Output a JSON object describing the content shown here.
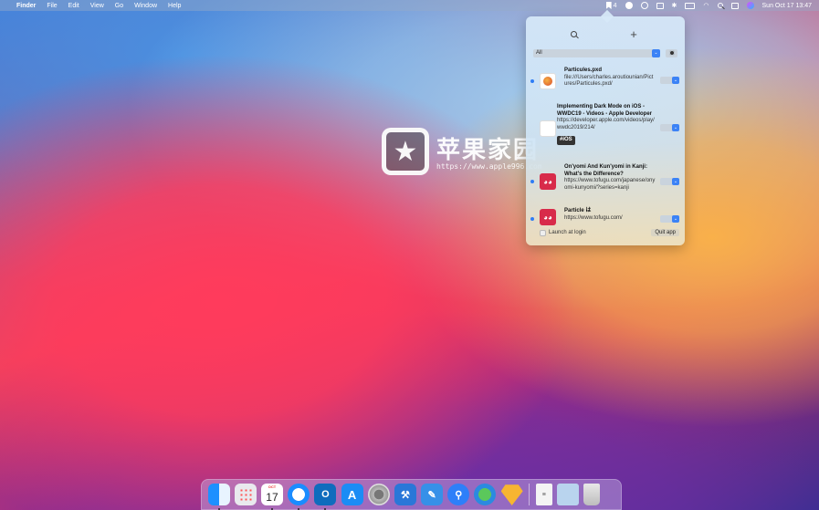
{
  "menubar": {
    "app_name": "Finder",
    "menus": [
      "File",
      "Edit",
      "View",
      "Go",
      "Window",
      "Help"
    ],
    "bookmark_count": "4",
    "datetime": "Sun Oct 17  13:47",
    "status_icons": [
      "bookmark-icon",
      "circle-icon",
      "record-icon",
      "keyboard-a-icon",
      "bluetooth-icon",
      "battery-icon",
      "wifi-icon",
      "search-icon",
      "control-center-icon",
      "siri-icon"
    ]
  },
  "popover": {
    "filter": {
      "selected": "All"
    },
    "items": [
      {
        "title": "Particules.pxd",
        "subtitle": "file:///Users/charles.aroutiounian/Pictures/Particules.pxd/",
        "unread": true,
        "icon": "pixelmator-icon"
      },
      {
        "title": "Implementing Dark Mode on iOS - WWDC19 - Videos - Apple Developer",
        "subtitle": "https://developer.apple.com/videos/play/wwdc2019/214/",
        "tag": "#iOS",
        "unread": false,
        "icon": "apple-icon"
      },
      {
        "title": "On'yomi And Kun'yomi in Kanji: What's the Difference?",
        "subtitle": "https://www.tofugu.com/japanese/onyomi-kunyomi/?series=kanji",
        "unread": true,
        "icon": "tofugu-icon"
      },
      {
        "title": "Particle は",
        "subtitle": "https://www.tofugu.com/",
        "unread": true,
        "icon": "tofugu-icon"
      }
    ],
    "launch_at_login_label": "Launch at login",
    "quit_label": "Quit app"
  },
  "watermark": {
    "text": "苹果家园",
    "url": "https://www.apple996.com"
  },
  "dock": {
    "calendar_month": "OCT",
    "calendar_day": "17"
  }
}
